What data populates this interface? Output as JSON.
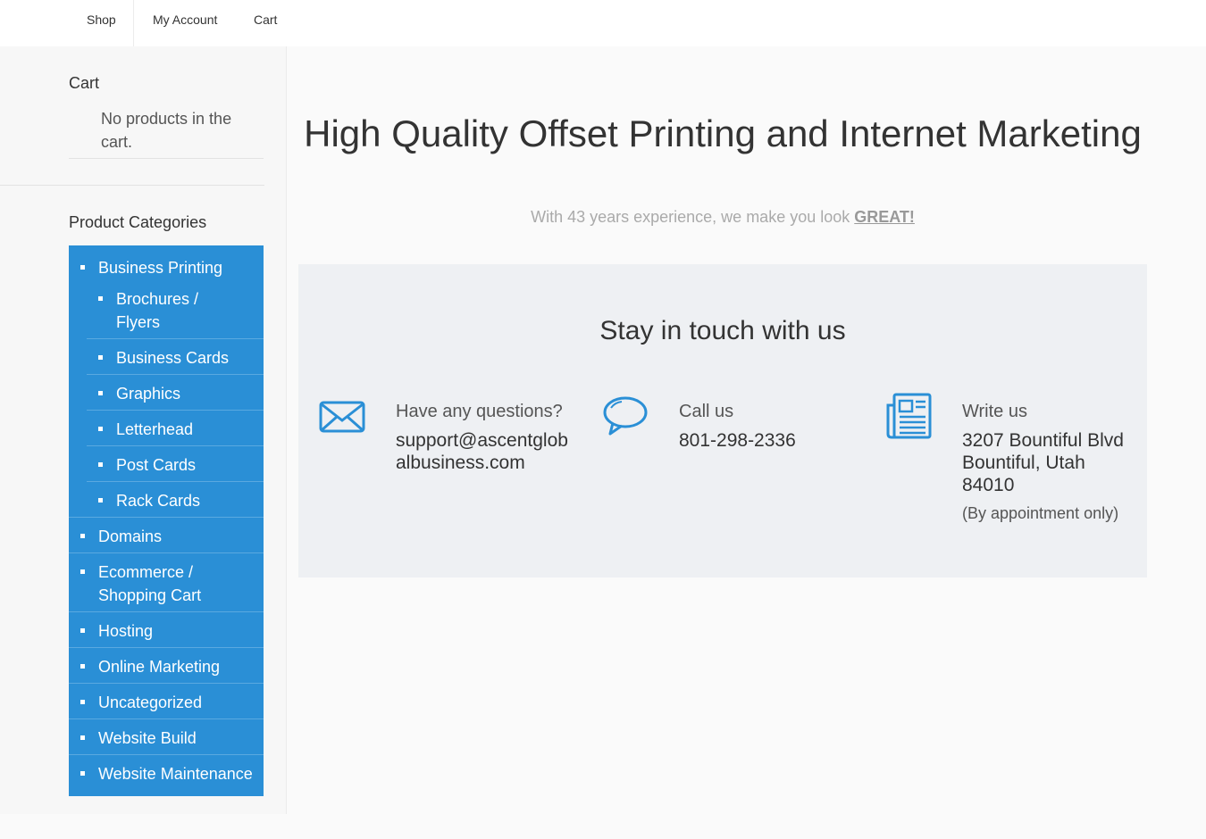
{
  "nav": {
    "items": [
      "Shop",
      "My Account",
      "Cart"
    ]
  },
  "sidebar": {
    "cart": {
      "title": "Cart",
      "empty_message": "No products in the cart."
    },
    "categories": {
      "title": "Product Categories",
      "items": [
        {
          "label": "Business Printing",
          "level": 0
        },
        {
          "label": "Brochures / Flyers",
          "level": 1
        },
        {
          "label": "Business Cards",
          "level": 1
        },
        {
          "label": "Graphics",
          "level": 1
        },
        {
          "label": "Letterhead",
          "level": 1
        },
        {
          "label": "Post Cards",
          "level": 1
        },
        {
          "label": "Rack Cards",
          "level": 1
        },
        {
          "label": "Domains",
          "level": 0
        },
        {
          "label": "Ecommerce / Shopping Cart",
          "level": 0
        },
        {
          "label": "Hosting",
          "level": 0
        },
        {
          "label": "Online Marketing",
          "level": 0
        },
        {
          "label": "Uncategorized",
          "level": 0
        },
        {
          "label": "Website Build",
          "level": 0
        },
        {
          "label": "Website Maintenance",
          "level": 0
        }
      ]
    }
  },
  "hero": {
    "title": "High Quality Offset Printing and Internet Marketing",
    "subtitle_prefix": "With 43 years experience, we make you look ",
    "subtitle_highlight": "GREAT!"
  },
  "contact": {
    "title": "Stay in touch with us",
    "email": {
      "icon": "envelope-icon",
      "label": "Have any questions?",
      "value": "support@ascentglobalbusiness.com"
    },
    "phone": {
      "icon": "speech-bubble-icon",
      "label": "Call us",
      "value": "801-298-2336"
    },
    "address": {
      "icon": "newspaper-icon",
      "label": "Write us",
      "line1": "3207 Bountiful Blvd",
      "line2": "Bountiful, Utah",
      "line3": "84010",
      "note": "(By appointment only)"
    }
  },
  "colors": {
    "accent": "#2a8fd6",
    "panel_bg": "#eef0f3",
    "page_bg": "#fafafa"
  }
}
